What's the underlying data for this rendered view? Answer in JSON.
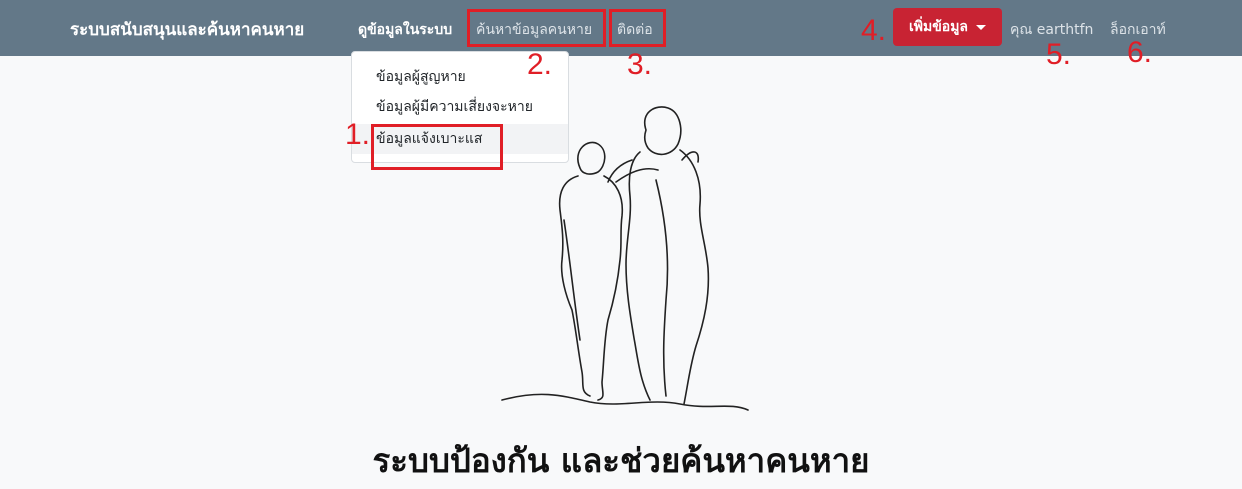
{
  "navbar": {
    "brand": "ระบบสนับสนุนและค้นหาคนหาย",
    "links": [
      {
        "label": "ดูข้อมูลในระบบ"
      },
      {
        "label": "ค้นหาข้อมูลคนหาย"
      },
      {
        "label": "ติดต่อ"
      }
    ],
    "add_button_label": "เพิ่มข้อมูล",
    "user_label": "คุณ earthtfn",
    "logout_label": "ล็อกเอาท์"
  },
  "dropdown": {
    "items": [
      {
        "label": "ข้อมูลผู้สูญหาย"
      },
      {
        "label": "ข้อมูลผู้มีความเสี่ยงจะหาย"
      },
      {
        "label": "ข้อมูลแจ้งเบาะแส"
      }
    ]
  },
  "annotations": [
    "1.",
    "2.",
    "3.",
    "4.",
    "5.",
    "6."
  ],
  "hero": {
    "illustration": "two-people-walking-line-art",
    "title": "ระบบป้องกัน และช่วยค้นหาคนหาย"
  },
  "colors": {
    "navbar": "#637888",
    "add_button": "#c82333",
    "annotation": "#e01e26"
  }
}
